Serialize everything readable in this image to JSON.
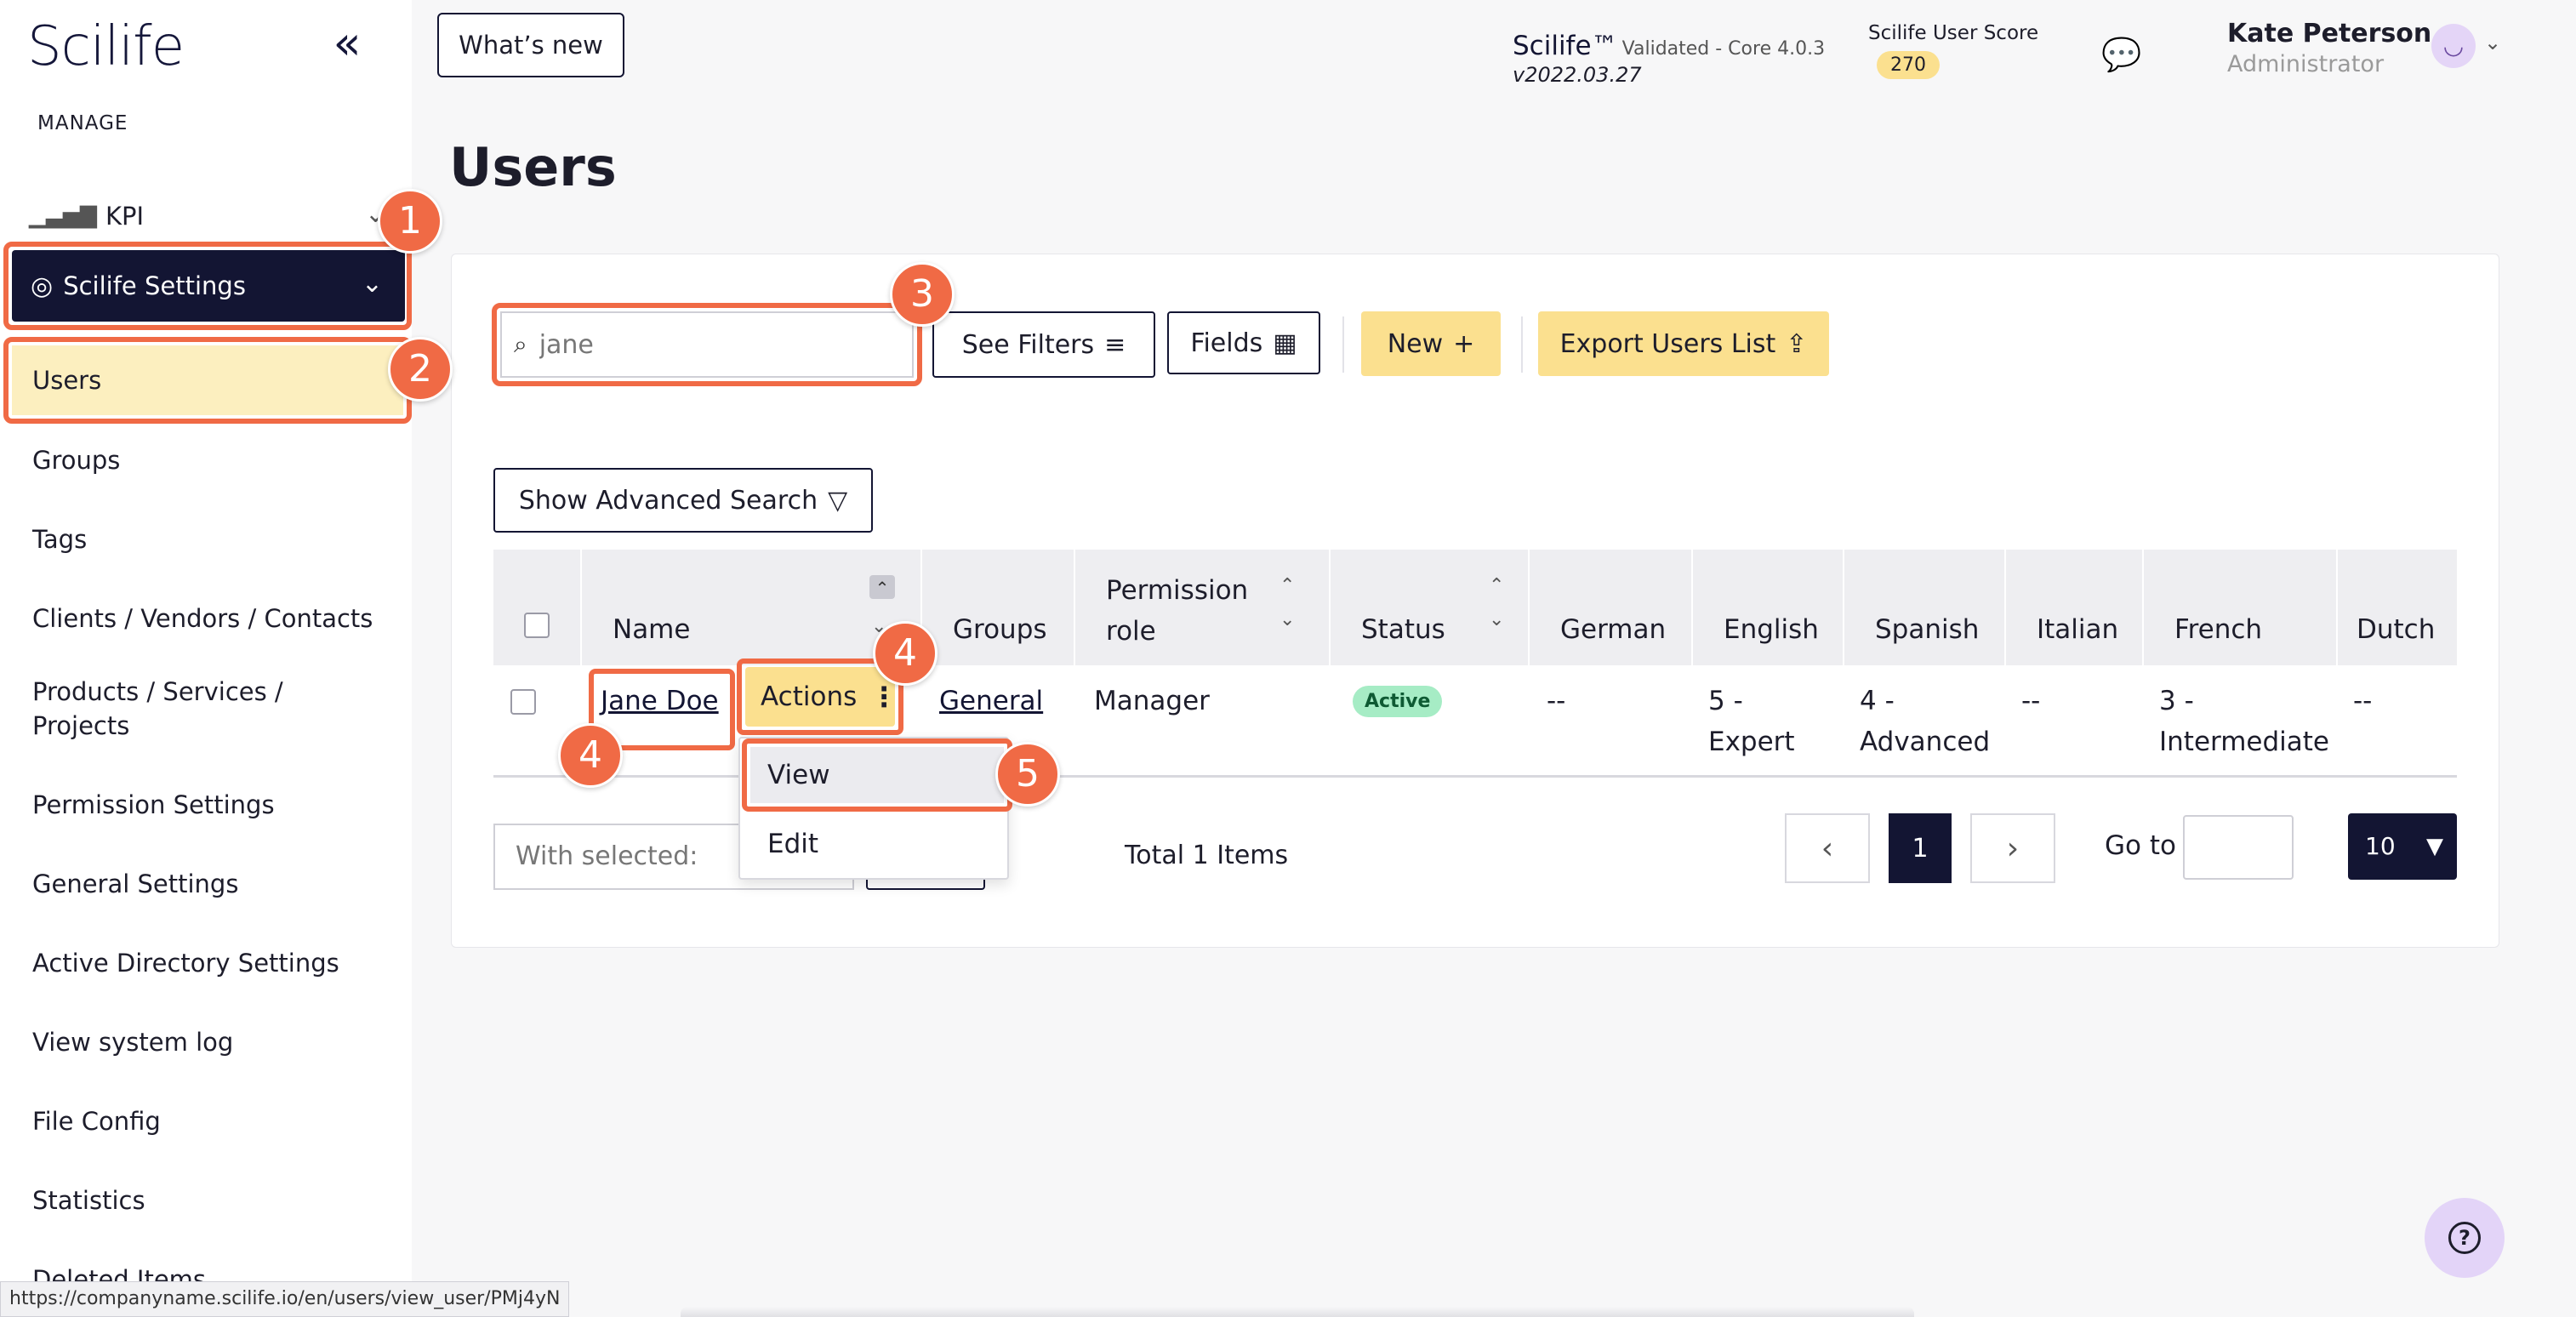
{
  "sidebar": {
    "logo": "Scilife",
    "collapse_icon": "«",
    "section_label": "MANAGE",
    "kpi_label": "KPI",
    "settings_label": "Scilife Settings",
    "items": [
      "Users",
      "Groups",
      "Tags",
      "Clients / Vendors / Contacts",
      "Products / Services / Projects",
      "Permission Settings",
      "General Settings",
      "Active Directory Settings",
      "View system log",
      "File Config",
      "Statistics",
      "Deleted Items"
    ]
  },
  "header": {
    "whats_new": "What’s new",
    "brand": "Scilife™",
    "validated": "Validated - Core 4.0.3",
    "version": "v2022.03.27",
    "score_label": "Scilife User Score",
    "score_value": "270",
    "user_name": "Kate Peterson",
    "user_role": "Administrator"
  },
  "main": {
    "title": "Users",
    "search_value": "jane",
    "see_filters": "See Filters",
    "fields": "Fields",
    "new": "New",
    "export": "Export Users List",
    "advanced_search": "Show Advanced Search",
    "columns": [
      "Name",
      "Groups",
      "Permission role",
      "Status",
      "German",
      "English",
      "Spanish",
      "Italian",
      "French",
      "Dutch"
    ],
    "row": {
      "name": "Jane Doe",
      "actions": "Actions",
      "group": "General",
      "role": "Manager",
      "status": "Active",
      "german": "--",
      "english": "5 - Expert",
      "spanish": "4 - Advanced",
      "italian": "--",
      "french": "3 - Intermediate",
      "dutch": "--"
    },
    "menu": {
      "view": "View",
      "edit": "Edit"
    },
    "with_selected_placeholder": "With selected:",
    "total": "Total 1 Items",
    "page_current": "1",
    "goto_label": "Go to",
    "page_size": "10"
  },
  "steps": [
    "1",
    "2",
    "3",
    "4",
    "4",
    "5"
  ],
  "statusbar_url": "https://companyname.scilife.io/en/users/view_user/PMj4yN",
  "colors": {
    "navy": "#131533",
    "highlight": "#f06a45",
    "yellow": "#fbe08f",
    "selected": "#fcefbf",
    "active_badge": "#a6ecc5"
  }
}
